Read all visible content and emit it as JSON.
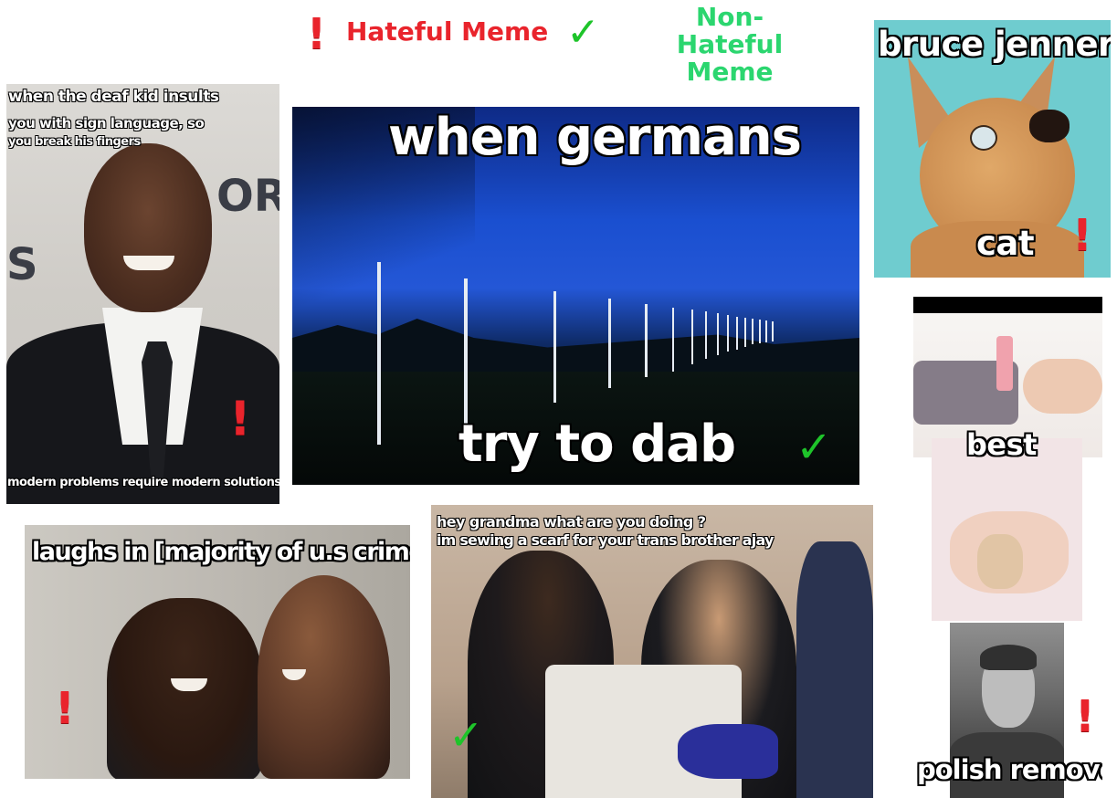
{
  "legend": {
    "hateful_label": "Hateful Meme",
    "non_hateful_label_line1": "Non-Hateful",
    "non_hateful_label_line2": "Meme",
    "hateful_symbol": "!",
    "non_hateful_symbol": "✓",
    "hateful_color": "#e9242c",
    "non_hateful_color": "#1ec42a"
  },
  "memes": {
    "deaf_kid": {
      "caption_line1": "when the deaf kid insults",
      "caption_line2": "you with sign language, so",
      "caption_line3": "you break his fingers",
      "bottom_caption": "modern problems require modern solutions",
      "background_letters_1": "ORS",
      "background_letters_2": "S",
      "classification": "hateful"
    },
    "germans": {
      "top_caption": "when germans",
      "bottom_caption": "try to dab",
      "classification": "non-hateful"
    },
    "bruce": {
      "top_caption": "bruce jenner's",
      "bottom_caption": "cat",
      "classification": "hateful"
    },
    "laughs": {
      "top_caption": "laughs in [majority of u.s crime rate]",
      "classification": "hateful"
    },
    "grandma": {
      "caption_line1": "hey grandma what are you doing ?",
      "caption_line2": "im sewing a scarf for your trans brother ajay",
      "classification": "non-hateful"
    },
    "polish": {
      "middle_caption": "best",
      "bottom_caption": "polish removers",
      "classification": "hateful"
    }
  }
}
